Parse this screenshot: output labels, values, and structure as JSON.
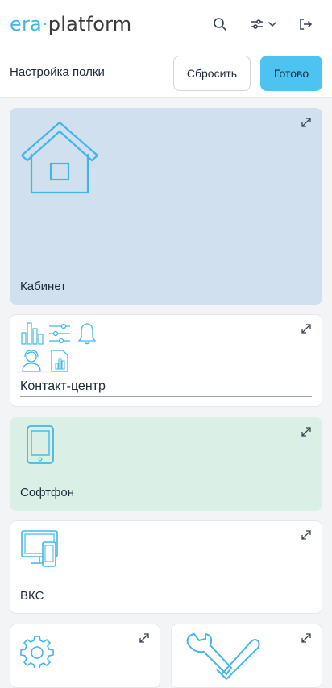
{
  "header": {
    "logo_era": "era",
    "logo_dot": "·",
    "logo_platform": "platform",
    "icons": [
      "search-icon",
      "filters-icon",
      "chevron-down-icon",
      "logout-icon"
    ]
  },
  "toolbar": {
    "title": "Настройка полки",
    "reset_label": "Сбросить",
    "done_label": "Готово"
  },
  "widgets": [
    {
      "label": "Кабинет",
      "icon": "house-icon",
      "color": "#d0e0ee"
    },
    {
      "label": "Контакт-центр",
      "icons": [
        "bar-chart-icon",
        "sliders-icon",
        "bell-icon",
        "operator-icon",
        "report-icon"
      ],
      "color": "#ffffff"
    },
    {
      "label": "Софтфон",
      "icon": "phone-icon",
      "color": "#daf0e6"
    },
    {
      "label": "ВКС",
      "icon": "devices-icon",
      "color": "#ffffff"
    },
    {
      "label": "",
      "icon": "gear-icon",
      "color": "#ffffff"
    },
    {
      "label": "",
      "icon": "tools-icon",
      "color": "#ffffff"
    }
  ],
  "colors": {
    "accent": "#4cc3f0",
    "icon_stroke": "#42b6e8"
  }
}
